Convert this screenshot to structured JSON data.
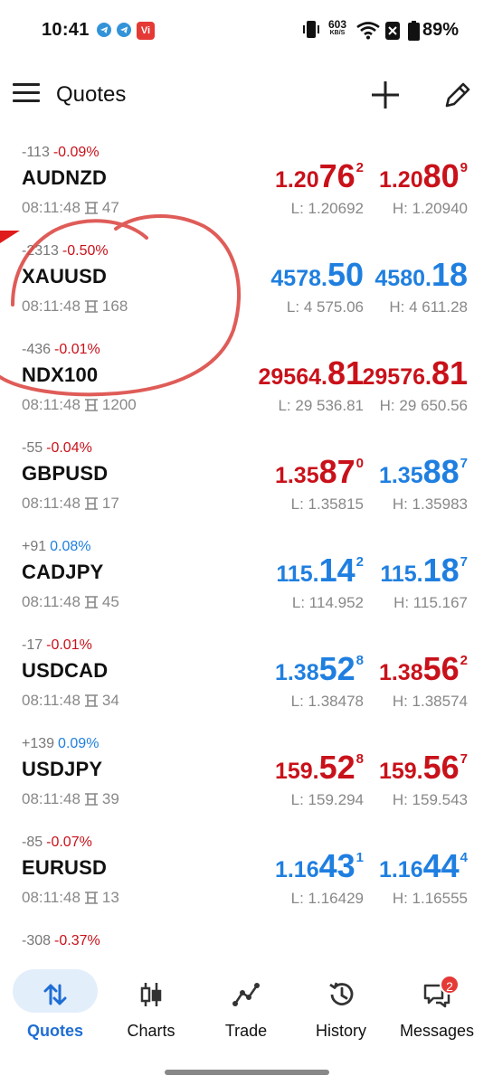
{
  "status_bar": {
    "time": "10:41",
    "net_speed_value": "603",
    "net_speed_unit": "KB/S",
    "battery_pct": "89%",
    "vi_label": "Vi"
  },
  "app_bar": {
    "title": "Quotes"
  },
  "quotes": [
    {
      "change": "-113",
      "pct": "-0.09%",
      "pct_color": "red",
      "symbol": "AUDNZD",
      "time": "08:11:48",
      "spread": "47",
      "bid": {
        "small": "1.20",
        "big": "76",
        "sup": "2",
        "color": "red"
      },
      "ask": {
        "small": "1.20",
        "big": "80",
        "sup": "9",
        "color": "red"
      },
      "low": "L: 1.20692",
      "high": "H: 1.20940"
    },
    {
      "change": "-2313",
      "pct": "-0.50%",
      "pct_color": "red",
      "symbol": "XAUUSD",
      "time": "08:11:48",
      "spread": "168",
      "bid": {
        "small": "4578.",
        "big": "50",
        "sup": "",
        "color": "blue"
      },
      "ask": {
        "small": "4580.",
        "big": "18",
        "sup": "",
        "color": "blue"
      },
      "low": "L: 4 575.06",
      "high": "H: 4 611.28"
    },
    {
      "change": "-436",
      "pct": "-0.01%",
      "pct_color": "red",
      "symbol": "NDX100",
      "time": "08:11:48",
      "spread": "1200",
      "bid": {
        "small": "29564.",
        "big": "81",
        "sup": "",
        "color": "red"
      },
      "ask": {
        "small": "29576.",
        "big": "81",
        "sup": "",
        "color": "red"
      },
      "low": "L: 29 536.81",
      "high": "H: 29 650.56"
    },
    {
      "change": "-55",
      "pct": "-0.04%",
      "pct_color": "red",
      "symbol": "GBPUSD",
      "time": "08:11:48",
      "spread": "17",
      "bid": {
        "small": "1.35",
        "big": "87",
        "sup": "0",
        "color": "red"
      },
      "ask": {
        "small": "1.35",
        "big": "88",
        "sup": "7",
        "color": "blue"
      },
      "low": "L: 1.35815",
      "high": "H: 1.35983"
    },
    {
      "change": "+91",
      "pct": "0.08%",
      "pct_color": "blue",
      "symbol": "CADJPY",
      "time": "08:11:48",
      "spread": "45",
      "bid": {
        "small": "115.",
        "big": "14",
        "sup": "2",
        "color": "blue"
      },
      "ask": {
        "small": "115.",
        "big": "18",
        "sup": "7",
        "color": "blue"
      },
      "low": "L: 114.952",
      "high": "H: 115.167"
    },
    {
      "change": "-17",
      "pct": "-0.01%",
      "pct_color": "red",
      "symbol": "USDCAD",
      "time": "08:11:48",
      "spread": "34",
      "bid": {
        "small": "1.38",
        "big": "52",
        "sup": "8",
        "color": "blue"
      },
      "ask": {
        "small": "1.38",
        "big": "56",
        "sup": "2",
        "color": "red"
      },
      "low": "L: 1.38478",
      "high": "H: 1.38574"
    },
    {
      "change": "+139",
      "pct": "0.09%",
      "pct_color": "blue",
      "symbol": "USDJPY",
      "time": "08:11:48",
      "spread": "39",
      "bid": {
        "small": "159.",
        "big": "52",
        "sup": "8",
        "color": "red"
      },
      "ask": {
        "small": "159.",
        "big": "56",
        "sup": "7",
        "color": "red"
      },
      "low": "L: 159.294",
      "high": "H: 159.543"
    },
    {
      "change": "-85",
      "pct": "-0.07%",
      "pct_color": "red",
      "symbol": "EURUSD",
      "time": "08:11:48",
      "spread": "13",
      "bid": {
        "small": "1.16",
        "big": "43",
        "sup": "1",
        "color": "blue"
      },
      "ask": {
        "small": "1.16",
        "big": "44",
        "sup": "4",
        "color": "blue"
      },
      "low": "L: 1.16429",
      "high": "H: 1.16555"
    },
    {
      "change": "-308",
      "pct": "-0.37%",
      "pct_color": "red",
      "symbol": "",
      "time": "",
      "spread": "",
      "bid": {
        "small": "",
        "big": "",
        "sup": "",
        "color": "blue"
      },
      "ask": {
        "small": "",
        "big": "",
        "sup": "",
        "color": "blue"
      },
      "low": "",
      "high": ""
    }
  ],
  "bottom_nav": {
    "quotes": "Quotes",
    "charts": "Charts",
    "trade": "Trade",
    "history": "History",
    "messages": "Messages",
    "messages_badge": "2",
    "active": "quotes"
  }
}
